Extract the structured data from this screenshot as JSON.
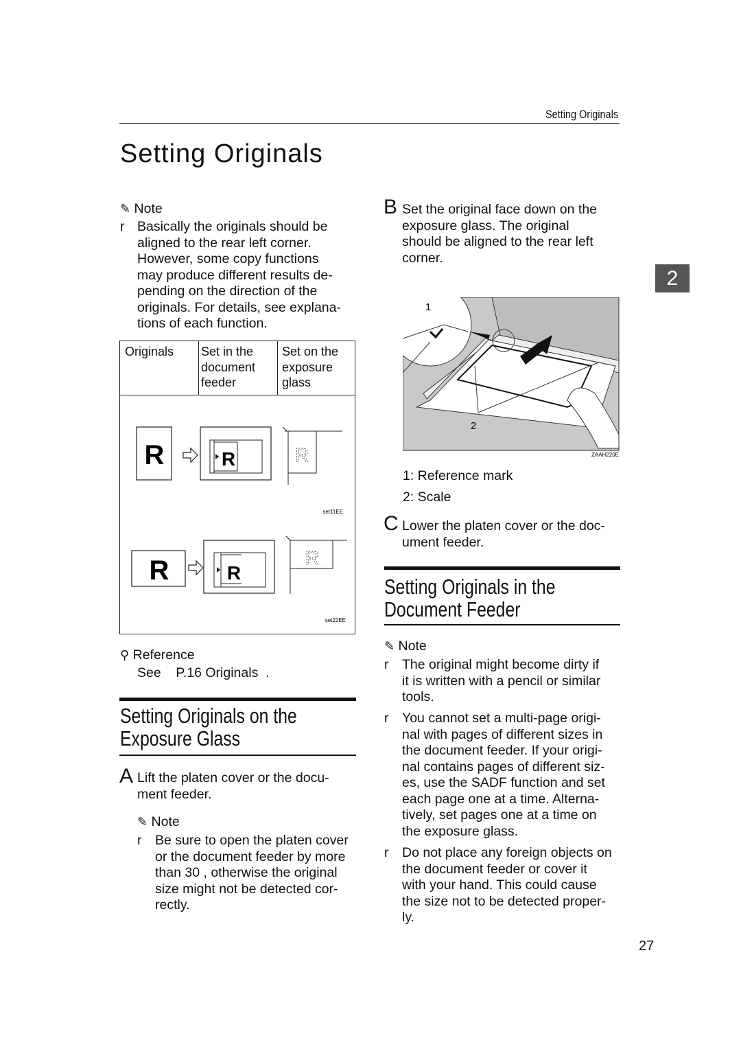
{
  "header": {
    "running_title": "Setting Originals"
  },
  "page_title": "Setting Originals",
  "chapter_tab": "2",
  "page_number": "27",
  "left": {
    "note1": {
      "label": "Note",
      "bullet": "r",
      "text": "Basically the originals should be\naligned to the rear left corner.\nHowever, some copy functions\nmay produce different results de-\npending on the direction of the\noriginals. For details, see explana-\ntions of each function."
    },
    "table": {
      "headers": [
        "Originals",
        "Set in the\ndocument\nfeeder",
        "Set on the\nexposure\nglass"
      ],
      "figure_ids": [
        "set11EE",
        "set22EE"
      ],
      "glyph": "R"
    },
    "reference": {
      "label": "Reference",
      "text": "See    P.16 Originals  ."
    },
    "section_heading": "Setting Originals on the\nExposure Glass",
    "step_a": {
      "letter": "A",
      "text": "Lift the platen cover or the docu-\nment feeder."
    },
    "note2": {
      "label": "Note",
      "bullet": "r",
      "text": "Be sure to open the platen cover\nor the document feeder by more\nthan 30 , otherwise the original\nsize might not be detected cor-\nrectly."
    }
  },
  "right": {
    "step_b": {
      "letter": "B",
      "text": "Set the original face down on the\nexposure glass. The original\nshould be aligned to the rear left\ncorner."
    },
    "figure": {
      "id": "ZAAH220E",
      "callout1": "1",
      "callout2": "2"
    },
    "legend": [
      "1: Reference mark",
      "2: Scale"
    ],
    "step_c": {
      "letter": "C",
      "text": "Lower the platen cover or the doc-\nument feeder."
    },
    "section_heading": "Setting Originals in the\nDocument Feeder",
    "note": {
      "label": "Note",
      "bullets": [
        {
          "mark": "r",
          "text": "The original might become dirty if\nit is written with a pencil or similar\ntools."
        },
        {
          "mark": "r",
          "text": "You cannot set a multi-page origi-\nnal with pages of different sizes in\nthe document feeder. If your origi-\nnal contains pages of different siz-\nes, use the SADF function and set\neach page one at a time. Alterna-\ntively, set pages one at a time on\nthe exposure glass."
        },
        {
          "mark": "r",
          "text": "Do not place any foreign objects on\nthe document feeder or cover it\nwith your hand. This could cause\nthe size not to be detected proper-\nly."
        }
      ]
    }
  }
}
